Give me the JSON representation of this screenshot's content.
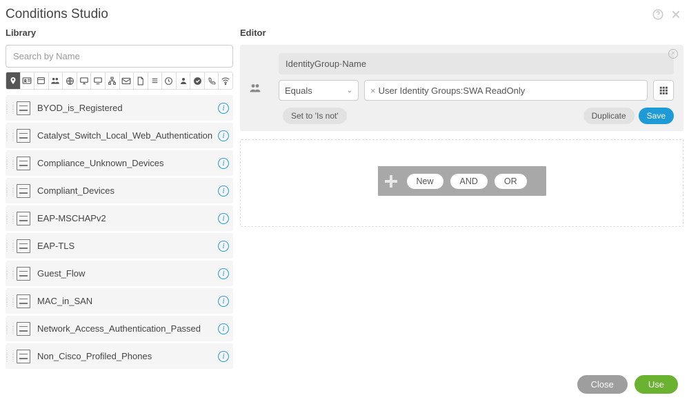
{
  "header": {
    "title": "Conditions Studio"
  },
  "library": {
    "label": "Library",
    "search_placeholder": "Search by Name",
    "items": [
      {
        "label": "BYOD_is_Registered"
      },
      {
        "label": "Catalyst_Switch_Local_Web_Authentication"
      },
      {
        "label": "Compliance_Unknown_Devices"
      },
      {
        "label": "Compliant_Devices"
      },
      {
        "label": "EAP-MSCHAPv2"
      },
      {
        "label": "EAP-TLS"
      },
      {
        "label": "Guest_Flow"
      },
      {
        "label": "MAC_in_SAN"
      },
      {
        "label": "Network_Access_Authentication_Passed"
      },
      {
        "label": "Non_Cisco_Profiled_Phones"
      }
    ]
  },
  "editor": {
    "label": "Editor",
    "attribute": "IdentityGroup·Name",
    "operator": "Equals",
    "value": "User Identity Groups:SWA ReadOnly",
    "set_is_not": "Set to 'Is not'",
    "duplicate": "Duplicate",
    "save": "Save",
    "add": {
      "new": "New",
      "and": "AND",
      "or": "OR"
    }
  },
  "footer": {
    "close": "Close",
    "use": "Use"
  }
}
